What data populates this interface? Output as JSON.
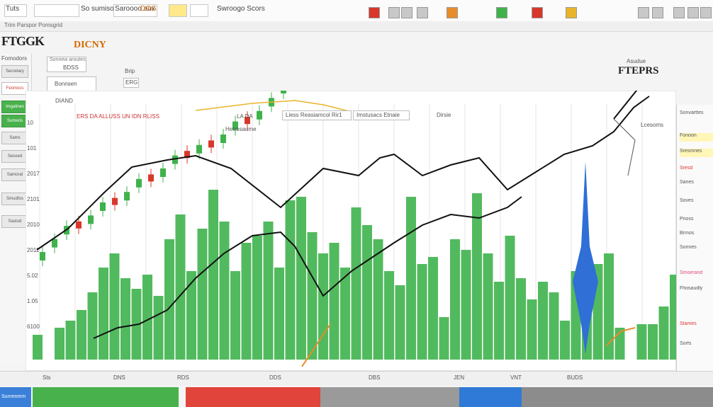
{
  "window": {
    "toolbar_texts": [
      "Tuts",
      "So sumisoov",
      "Saroooo aux",
      "DOG",
      "Swroogo Scors"
    ],
    "toolbar_subtitle": "Trim Parspor Pomsgrid"
  },
  "brand": {
    "logo": "FTGGK",
    "logo2": "DICNY"
  },
  "left_panel": {
    "header": "Fomodors",
    "items": [
      "Secretary",
      "Imgatines",
      "Sumeris",
      "Sams",
      "Sesoed",
      "Samoral",
      "Smudfos",
      "Sastud"
    ],
    "labels_red": [
      "Feomocs"
    ]
  },
  "top_panels": {
    "panel_a_title": "Sonnew aroutes",
    "panel_a_value": "BDSS",
    "panel_b_value": "Bonnsen",
    "panel_c_value": "ERG",
    "panel_d_value": "Brip"
  },
  "chart_header": {
    "left_label": "DIAND",
    "series_label": "ERS DA ALLUSS UN IDN RLISS",
    "center_label": "LA DA",
    "center_box": "Liess Reasiamcol Rir1",
    "center_box2": "Imstusacs Etnaie",
    "right_label": "Dirsie",
    "sub_a": "Hetrosaume",
    "sub_b": "Lcesoms"
  },
  "ticker": {
    "sub": "Asudue",
    "name": "FTEPRS"
  },
  "right_panel": {
    "items": [
      "Sonvarttes",
      "Fonoon",
      "Sresmnes",
      "Sresd",
      "Sanes",
      "Soves",
      "Pnoss",
      "Brmos",
      "Sorines",
      "Smoerand",
      "Fhosaudly",
      "Stames",
      "Sorfs"
    ]
  },
  "status_bar": {
    "items": [
      "Sts",
      "DNS",
      "RDS",
      "DDS",
      "DBS",
      "JEN",
      "VNT",
      "BUDS"
    ]
  },
  "bottom_bar": {
    "label": "Sunreomm"
  },
  "colors": {
    "bull": "#3fb24c",
    "bear": "#d8372b",
    "blue": "#2f6fd6",
    "gray": "#8c8c8c",
    "trend": "#111111"
  },
  "chart_data": {
    "type": "bar",
    "y_tick_labels": [
      "10",
      "101",
      "2017",
      "2101",
      "2010",
      "2011",
      "5.02",
      "1.05",
      "6100"
    ],
    "volume_bars": [
      14,
      0,
      18,
      22,
      28,
      38,
      52,
      60,
      46,
      40,
      48,
      36,
      68,
      82,
      50,
      74,
      96,
      78,
      50,
      66,
      70,
      78,
      52,
      90,
      92,
      72,
      60,
      66,
      52,
      86,
      76,
      68,
      50,
      42,
      92,
      54,
      58,
      24,
      68,
      62,
      94,
      60,
      44,
      70,
      46,
      34,
      44,
      38,
      22,
      50,
      58,
      54,
      60,
      18,
      0,
      20,
      20,
      30,
      48
    ],
    "candles_up": [
      true,
      true,
      true,
      false,
      true,
      true,
      false,
      true,
      true,
      false,
      true,
      true,
      false,
      true,
      false,
      true,
      true,
      false,
      true,
      true,
      true,
      true,
      false,
      true,
      true,
      false,
      true,
      true,
      false,
      true,
      true,
      false,
      true,
      true,
      true,
      false,
      true,
      true,
      false,
      true,
      true,
      true,
      false,
      true,
      true
    ],
    "highlight_bar": "blue"
  }
}
